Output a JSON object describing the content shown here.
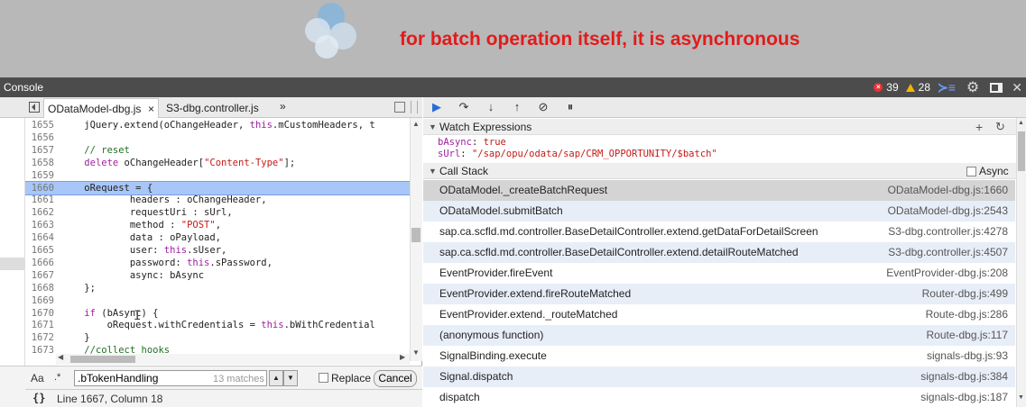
{
  "banner": {
    "annotation": "for batch operation itself, it is asynchronous",
    "annotation_color": "#e21b1b",
    "logo_icon": "four-petal-logo"
  },
  "console_bar": {
    "title": "Console",
    "error_count": "39",
    "warning_count": "28",
    "icons": [
      "error-icon",
      "warning-icon",
      "show-drawer-icon",
      "gear-icon",
      "dock-icon",
      "close-icon"
    ]
  },
  "editor": {
    "tabs": [
      {
        "label": "ODataModel-dbg.js",
        "close": "×",
        "active": true
      },
      {
        "label": "S3-dbg.controller.js",
        "active": false
      }
    ],
    "more_tabs": "»",
    "lines": [
      {
        "num": "1655",
        "html": "    jQuery.extend(oChangeHeader, <span class=\"kw\">this</span>.mCustomHeaders, t"
      },
      {
        "num": "1656",
        "html": ""
      },
      {
        "num": "1657",
        "html": "    <span class=\"cm\">// reset</span>"
      },
      {
        "num": "1658",
        "html": "    <span class=\"kw\">delete</span> oChangeHeader[<span class=\"str\">\"Content-Type\"</span>];"
      },
      {
        "num": "1659",
        "html": ""
      },
      {
        "num": "1660",
        "html": "    oRequest = {",
        "highlight": true
      },
      {
        "num": "1661",
        "html": "            headers : oChangeHeader,"
      },
      {
        "num": "1662",
        "html": "            requestUri : sUrl,"
      },
      {
        "num": "1663",
        "html": "            method : <span class=\"str\">\"POST\"</span>,"
      },
      {
        "num": "1664",
        "html": "            data : oPayload,"
      },
      {
        "num": "1665",
        "html": "            user: <span class=\"kw\">this</span>.sUser,"
      },
      {
        "num": "1666",
        "html": "            password: <span class=\"kw\">this</span>.sPassword,"
      },
      {
        "num": "1667",
        "html": "            async: bAsync"
      },
      {
        "num": "1668",
        "html": "    };"
      },
      {
        "num": "1669",
        "html": ""
      },
      {
        "num": "1670",
        "html": "    <span class=\"kw\">if</span> (bAsync) {"
      },
      {
        "num": "1671",
        "html": "        oRequest.withCredentials = <span class=\"kw\">this</span>.bWithCredential"
      },
      {
        "num": "1672",
        "html": "    }"
      },
      {
        "num": "1673",
        "html": "    <span class=\"cm\">//collect hooks</span>"
      }
    ],
    "search": {
      "case_label": "Aa",
      "regex_label": ".*",
      "query": ".bTokenHandling",
      "matches": "13 matches",
      "replace_label": "Replace",
      "cancel_label": "Cancel"
    },
    "status": "Line 1667, Column 18",
    "format_label": "{}"
  },
  "debugger": {
    "toolbar_icons": [
      "resume-icon",
      "step-over-icon",
      "step-into-icon",
      "step-out-icon",
      "deactivate-breakpoints-icon",
      "pause-on-exceptions-icon"
    ],
    "watch_title": "Watch Expressions",
    "watch": [
      {
        "name": "bAsync",
        "value": "true"
      },
      {
        "name": "sUrl",
        "value": "\"/sap/opu/odata/sap/CRM_OPPORTUNITY/$batch\""
      }
    ],
    "call_stack_title": "Call Stack",
    "async_label": "Async",
    "frames": [
      {
        "name": "ODataModel._createBatchRequest",
        "location": "ODataModel-dbg.js:1660"
      },
      {
        "name": "ODataModel.submitBatch",
        "location": "ODataModel-dbg.js:2543"
      },
      {
        "name": "sap.ca.scfld.md.controller.BaseDetailController.extend.getDataForDetailScreen",
        "location": "S3-dbg.controller.js:4278"
      },
      {
        "name": "sap.ca.scfld.md.controller.BaseDetailController.extend.detailRouteMatched",
        "location": "S3-dbg.controller.js:4507"
      },
      {
        "name": "EventProvider.fireEvent",
        "location": "EventProvider-dbg.js:208"
      },
      {
        "name": "EventProvider.extend.fireRouteMatched",
        "location": "Router-dbg.js:499"
      },
      {
        "name": "EventProvider.extend._routeMatched",
        "location": "Route-dbg.js:286"
      },
      {
        "name": "(anonymous function)",
        "location": "Route-dbg.js:117"
      },
      {
        "name": "SignalBinding.execute",
        "location": "signals-dbg.js:93"
      },
      {
        "name": "Signal.dispatch",
        "location": "signals-dbg.js:384"
      },
      {
        "name": "dispatch",
        "location": "signals-dbg.js:187"
      }
    ]
  }
}
